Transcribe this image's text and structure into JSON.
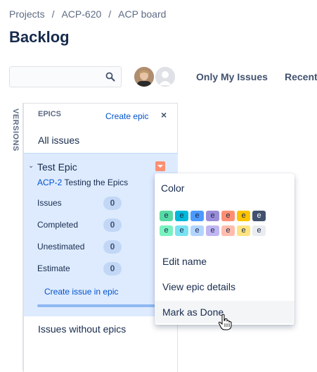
{
  "breadcrumb": {
    "items": [
      "Projects",
      "ACP-620",
      "ACP board"
    ],
    "separator": "/"
  },
  "page": {
    "title": "Backlog"
  },
  "toolbar": {
    "search_value": "",
    "only_my_issues": "Only My Issues",
    "recently_updated": "Recentl"
  },
  "versions_tab": {
    "label": "VERSIONS"
  },
  "epics_panel": {
    "header": "EPICS",
    "create_epic": "Create epic",
    "close": "×",
    "all_issues": "All issues",
    "epic": {
      "name": "Test Epic",
      "key": "ACP-2",
      "summary": "Testing the Epics",
      "color": "#ff8f73",
      "stats": [
        {
          "label": "Issues",
          "value": "0"
        },
        {
          "label": "Completed",
          "value": "0"
        },
        {
          "label": "Unestimated",
          "value": "0"
        },
        {
          "label": "Estimate",
          "value": "0"
        }
      ],
      "create_issue": "Create issue in epic",
      "progress": 1.0
    },
    "issues_without_epics": "Issues without epics"
  },
  "epic_menu": {
    "color_label": "Color",
    "swatch_letter": "e",
    "swatches_row1": [
      "#57d9a3",
      "#00b8d9",
      "#4c9aff",
      "#998dd9",
      "#ff8f73",
      "#ffc400",
      "#42526e"
    ],
    "swatches_row2": [
      "#79f2c0",
      "#79e2f2",
      "#b3d4ff",
      "#c0b6f2",
      "#ffbdad",
      "#ffe380",
      "#ebecf0"
    ],
    "items": [
      "Edit name",
      "View epic details",
      "Mark as Done"
    ]
  }
}
